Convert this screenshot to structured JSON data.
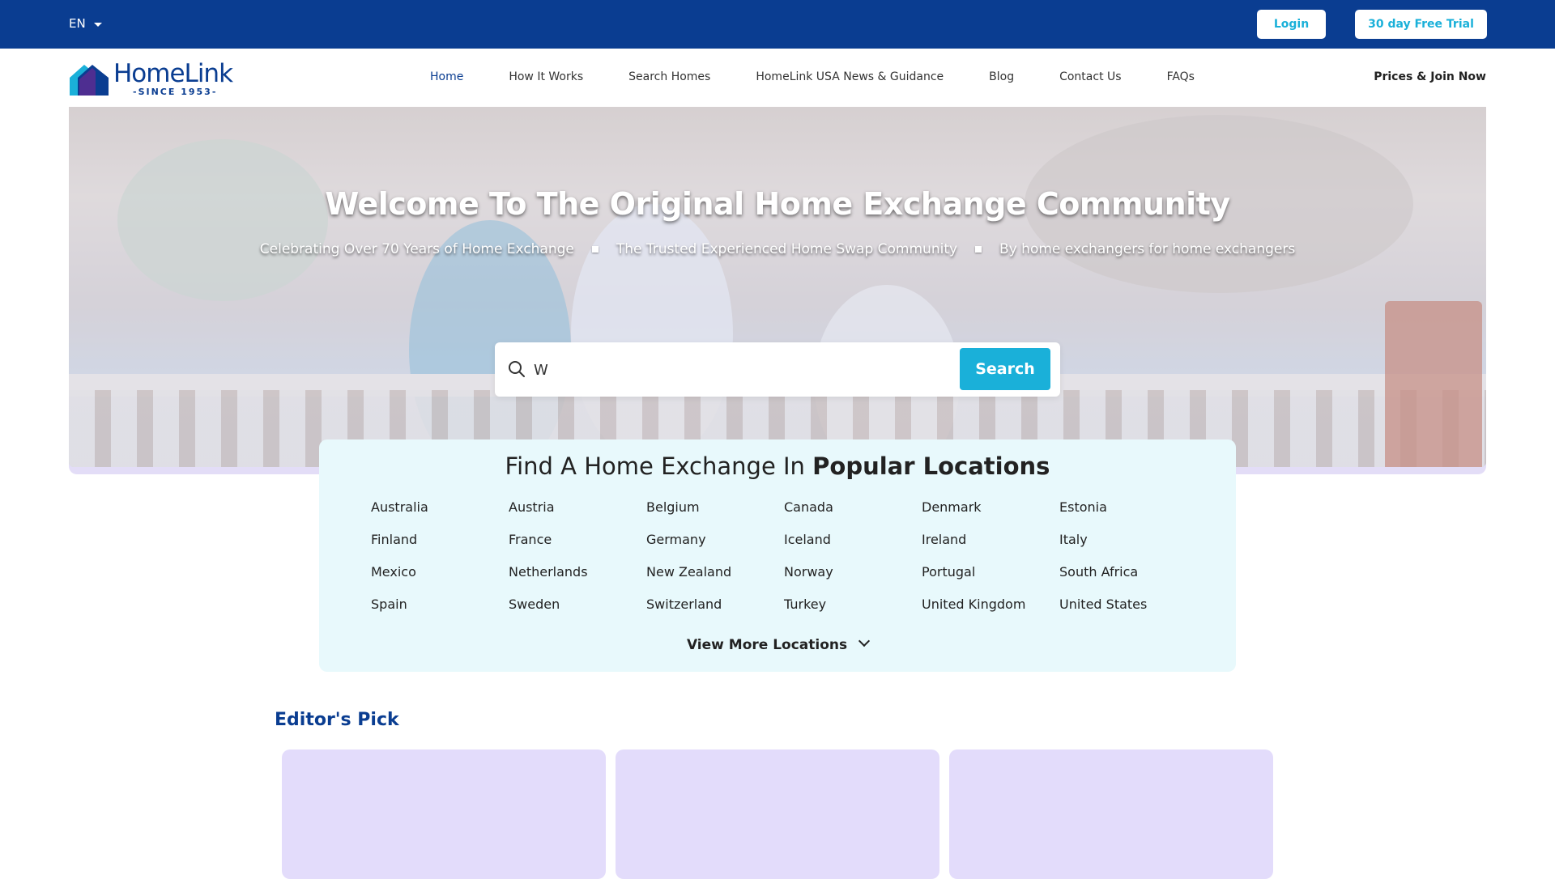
{
  "topbar": {
    "language": "EN",
    "login_label": "Login",
    "trial_label": "30 day Free Trial",
    "bg_color": "#0a3d91",
    "button_text_color": "#1ab0d9"
  },
  "logo": {
    "name": "HomeLink",
    "tagline": "-SINCE 1953-"
  },
  "nav": {
    "items": [
      {
        "label": "Home",
        "active": true
      },
      {
        "label": "How It Works"
      },
      {
        "label": "Search Homes"
      },
      {
        "label": "HomeLink USA News & Guidance"
      },
      {
        "label": "Blog"
      },
      {
        "label": "Contact Us"
      },
      {
        "label": "FAQs"
      }
    ],
    "prices_label": "Prices & Join Now"
  },
  "hero": {
    "title": "Welcome To The Original Home Exchange Community",
    "subtitles": [
      "Celebrating Over 70 Years of Home Exchange",
      "The Trusted Experienced Home Swap Community",
      "By home exchangers for home exchangers"
    ]
  },
  "search": {
    "value": "W",
    "button_label": "Search",
    "icon": "search-icon",
    "button_color": "#1ab0d9"
  },
  "locations": {
    "title_prefix": "Find A Home Exchange In",
    "title_bold": "Popular Locations",
    "countries": [
      "Australia",
      "Austria",
      "Belgium",
      "Canada",
      "Denmark",
      "Estonia",
      "Finland",
      "France",
      "Germany",
      "Iceland",
      "Ireland",
      "Italy",
      "Mexico",
      "Netherlands",
      "New Zealand",
      "Norway",
      "Portugal",
      "South Africa",
      "Spain",
      "Sweden",
      "Switzerland",
      "Turkey",
      "United Kingdom",
      "United States"
    ],
    "view_more_label": "View More Locations",
    "bg_color": "#e8f9fc"
  },
  "editors_pick": {
    "title": "Editor's Pick"
  }
}
